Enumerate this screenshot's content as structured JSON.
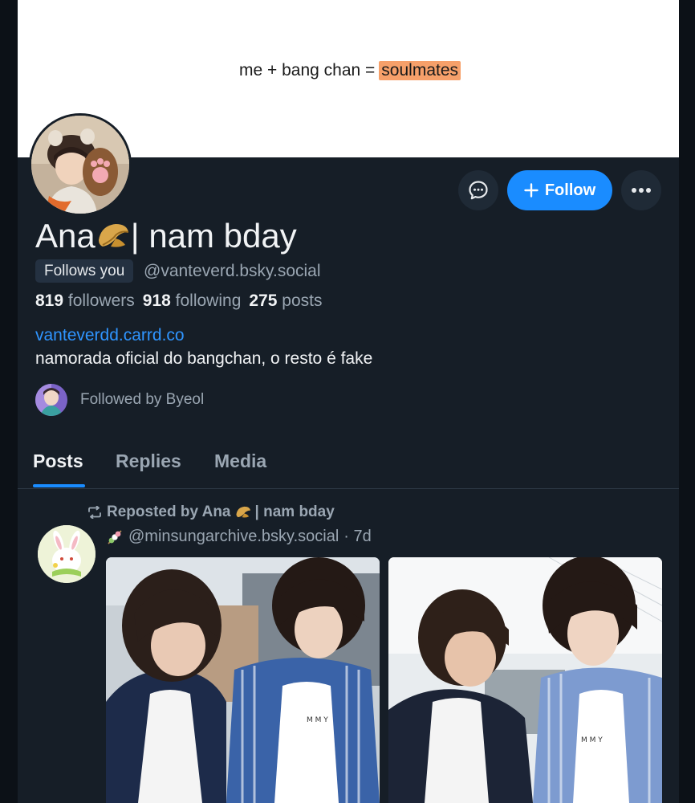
{
  "banner": {
    "text_prefix": "me + bang chan =",
    "highlight": "soulmates",
    "highlight_color": "#f6a06a"
  },
  "profile": {
    "name_part1": "Ana",
    "name_emoji": "fortune-cookie",
    "name_part2": "| nam bday",
    "follows_you": "Follows you",
    "handle": "@vanteverd.bsky.social",
    "followers_count": "819",
    "followers_label": "followers",
    "following_count": "918",
    "following_label": "following",
    "posts_count": "275",
    "posts_label": "posts",
    "link": "vanteverdd.carrd.co",
    "bio": "namorada oficial do bangchan, o resto é fake",
    "followed_by": "Followed by Byeol"
  },
  "actions": {
    "follow_label": "Follow"
  },
  "tabs": [
    {
      "label": "Posts",
      "active": true
    },
    {
      "label": "Replies",
      "active": false
    },
    {
      "label": "Media",
      "active": false
    }
  ],
  "post": {
    "repost_label": "Reposted by Ana",
    "repost_suffix": "| nam bday",
    "handle": "@minsungarchive.bsky.social",
    "time": "· 7d"
  },
  "colors": {
    "accent": "#1a8cff",
    "background": "#161e27",
    "muted_text": "#9aa6b2",
    "link": "#2f95ff"
  }
}
